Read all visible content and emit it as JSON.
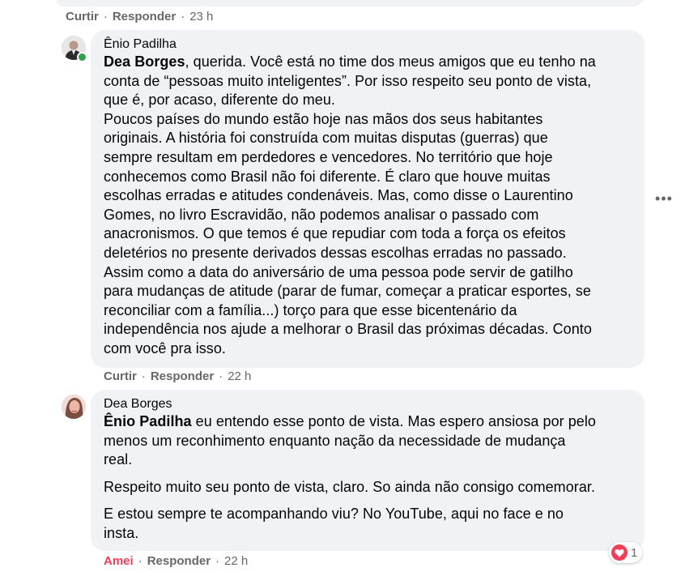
{
  "previous_comment": {
    "like_label": "Curtir",
    "reply_label": "Responder",
    "time": "23 h"
  },
  "comment_1": {
    "author": "Ênio Padilha",
    "mention": "Dea Borges",
    "lines": [
      ", querida. Você está no time dos meus amigos que eu tenho na",
      "conta de “pessoas muito inteligentes”. Por isso respeito seu ponto de vista,",
      "que é, por acaso, diferente do meu.",
      "Poucos países do mundo estão hoje nas mãos dos seus habitantes",
      "originais. A história foi construída com muitas disputas (guerras) que",
      "sempre resultam em perdedores e vencedores. No território que hoje",
      "conhecemos como Brasil não foi diferente. É claro que houve muitas",
      "escolhas erradas e atitudes condenáveis. Mas, como disse o Laurentino",
      "Gomes, no livro Escravidão, não podemos analisar o passado com",
      "anacronismos. O que temos é que repudiar com toda a força os efeitos",
      "deletérios no presente derivados dessas escolhas erradas no passado.",
      "Assim como a data do aniversário de uma pessoa pode servir de gatilho",
      "para mudanças de atitude (parar de fumar, começar a praticar esportes, se",
      "reconciliar com a família...) torço para que esse bicentenário da",
      "independência nos ajude a melhorar o Brasil das próximas décadas. Conto",
      "com você pra isso."
    ],
    "like_label": "Curtir",
    "reply_label": "Responder",
    "time": "22 h"
  },
  "comment_2": {
    "author": "Dea Borges",
    "mention": "Ênio Padilha",
    "lines_p1": [
      " eu entendo esse ponto de vista. Mas espero ansiosa por pelo",
      "menos um reconhimento enquanto nação da necessidade de mudança",
      "real."
    ],
    "p2": "Respeito muito seu ponto de vista, claro. So ainda não consigo comemorar.",
    "lines_p3": [
      "E estou sempre te acompanhando viu? No YouTube, aqui no face e no",
      "insta."
    ],
    "like_label": "Amei",
    "reply_label": "Responder",
    "time": "22 h",
    "reaction_count": "1"
  },
  "more_options": "•••",
  "colors": {
    "bubble": "#f0f2f5",
    "meta": "#65676b",
    "love": "#f33e58",
    "online": "#31a24c"
  }
}
